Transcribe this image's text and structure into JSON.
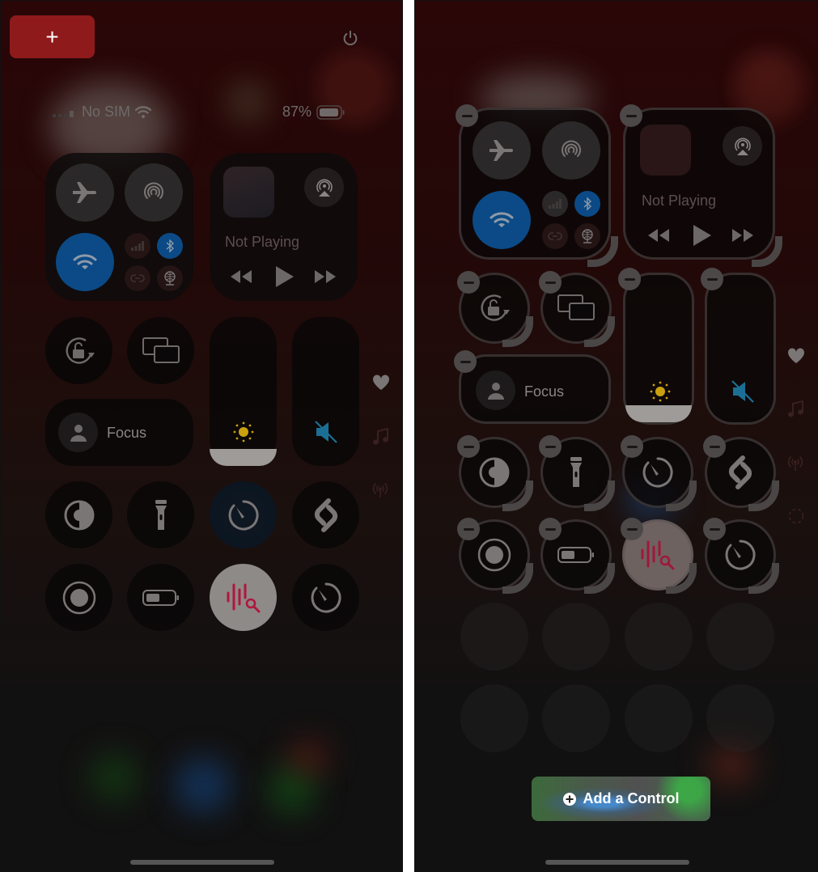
{
  "left_panel": {
    "add_button_label": "+",
    "status_bar": {
      "carrier": "No SIM",
      "battery_percent": "87%"
    },
    "connectivity": {
      "airplane_mode": "off",
      "airdrop": "off",
      "wifi": "on",
      "cellular": "off",
      "bluetooth": "on",
      "personal_hotspot": "off",
      "vpn": "off"
    },
    "now_playing": {
      "label": "Not Playing"
    },
    "controls": [
      {
        "name": "Orientation Lock",
        "icon": "rotation-lock-icon"
      },
      {
        "name": "Screen Mirroring",
        "icon": "screen-mirroring-icon"
      },
      {
        "name": "Focus",
        "label": "Focus",
        "icon": "person-icon"
      },
      {
        "name": "Brightness",
        "icon": "sun-icon",
        "level": 0.15
      },
      {
        "name": "Volume",
        "icon": "speaker-muted-icon",
        "level": 0
      },
      {
        "name": "Dark Mode",
        "icon": "dark-mode-icon"
      },
      {
        "name": "Flashlight",
        "icon": "flashlight-icon"
      },
      {
        "name": "Timer",
        "icon": "timer-icon",
        "active": true
      },
      {
        "name": "Shazam",
        "icon": "shazam-icon"
      },
      {
        "name": "Screen Recording",
        "icon": "record-icon"
      },
      {
        "name": "Low Power Mode",
        "icon": "battery-icon"
      },
      {
        "name": "Music Recognition",
        "icon": "music-recognition-icon",
        "active": true
      },
      {
        "name": "Stopwatch",
        "icon": "timer-icon"
      }
    ],
    "side_pages": [
      "favorites-heart-icon",
      "music-note-icon",
      "connectivity-antenna-icon"
    ]
  },
  "right_panel": {
    "mode": "edit",
    "now_playing": {
      "label": "Not Playing"
    },
    "focus_label": "Focus",
    "add_control_label": "Add a Control",
    "side_pages": [
      "favorites-heart-icon",
      "music-note-icon",
      "connectivity-antenna-icon",
      "new-page-dashed-circle-icon"
    ]
  },
  "colors": {
    "add_button": "#8e1a1b",
    "wifi_active": "#0a4a8a",
    "bluetooth_active": "#0a4a8a",
    "brightness_sun": "#c9a010",
    "volume_muted": "#1c6f94",
    "music_recognition": "#b0173d"
  }
}
